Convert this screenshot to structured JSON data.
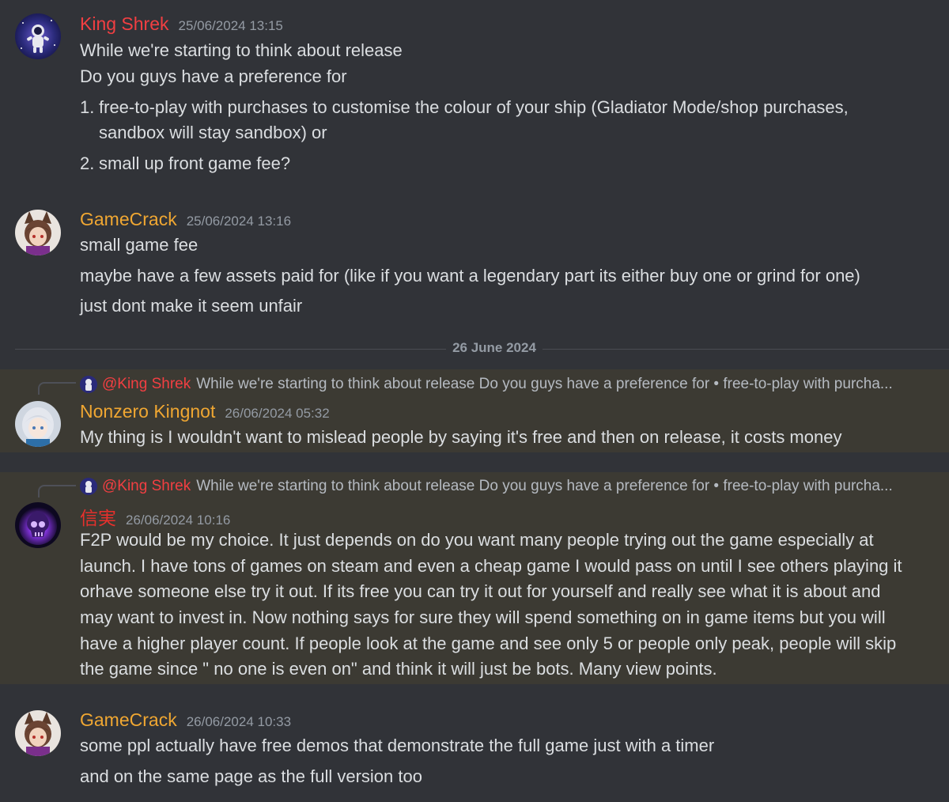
{
  "colors": {
    "background": "#313338",
    "mention_highlight": "#3c3a33",
    "king_shrek": "#f23f42",
    "orange_user": "#f0a732",
    "xinshi": "#e8302c",
    "timestamp": "#949ba4",
    "text": "#dbdee1"
  },
  "messages": [
    {
      "author": "King Shrek",
      "timestamp": "25/06/2024 13:15",
      "avatar_icon": "astronaut-avatar",
      "lines": [
        "While we're starting to think about release",
        "Do you guys have a preference for"
      ],
      "list": [
        {
          "num": "1.",
          "lines": [
            "free-to-play with purchases to customise the colour of your ship (Gladiator Mode/shop purchases,",
            "sandbox will stay sandbox) or"
          ]
        },
        {
          "num": "2.",
          "lines": [
            "small up front game fee?"
          ]
        }
      ]
    },
    {
      "author": "GameCrack",
      "timestamp": "25/06/2024 13:16",
      "avatar_icon": "anime-fox-avatar",
      "lines": [
        "small game fee",
        "maybe have a few assets paid for (like if you want a legendary part its either buy one or grind for one)",
        "just dont make it seem unfair"
      ]
    },
    {
      "author": "Nonzero Kingnot",
      "timestamp": "26/06/2024 05:32",
      "avatar_icon": "anime-girl-avatar",
      "reply": {
        "author": "@King Shrek",
        "content": "While we're starting to think about release Do you guys have a preference for  • free-to-play with purcha..."
      },
      "lines": [
        "My thing is I wouldn't want to mislead people by saying it's free and then on release, it costs money"
      ]
    },
    {
      "author": "信実",
      "timestamp": "26/06/2024 10:16",
      "avatar_icon": "purple-skull-avatar",
      "reply": {
        "author": "@King Shrek",
        "content": "While we're starting to think about release Do you guys have a preference for  • free-to-play with purcha..."
      },
      "lines": [
        "F2P would be my choice. It just depends on do you want many people trying out the game especially at",
        "launch. I have tons of games on steam and even a cheap game I would pass on until I see others playing it",
        "orhave someone else try it out. If its free you can try it out for yourself and really see what it is about and",
        "may want to invest in. Now nothing says for sure they will spend something on in game items but you will",
        "have a higher player count. If people look at the game and see only 5 or people only peak, people will skip",
        "the game since \" no one is even on\" and think it will just be bots. Many view points."
      ]
    },
    {
      "author": "GameCrack",
      "timestamp": "26/06/2024 10:33",
      "avatar_icon": "anime-fox-avatar",
      "lines": [
        "some ppl actually have free demos that demonstrate the full game just with a timer",
        "and on the same page as the full version too"
      ]
    }
  ],
  "date_divider": "26 June 2024"
}
